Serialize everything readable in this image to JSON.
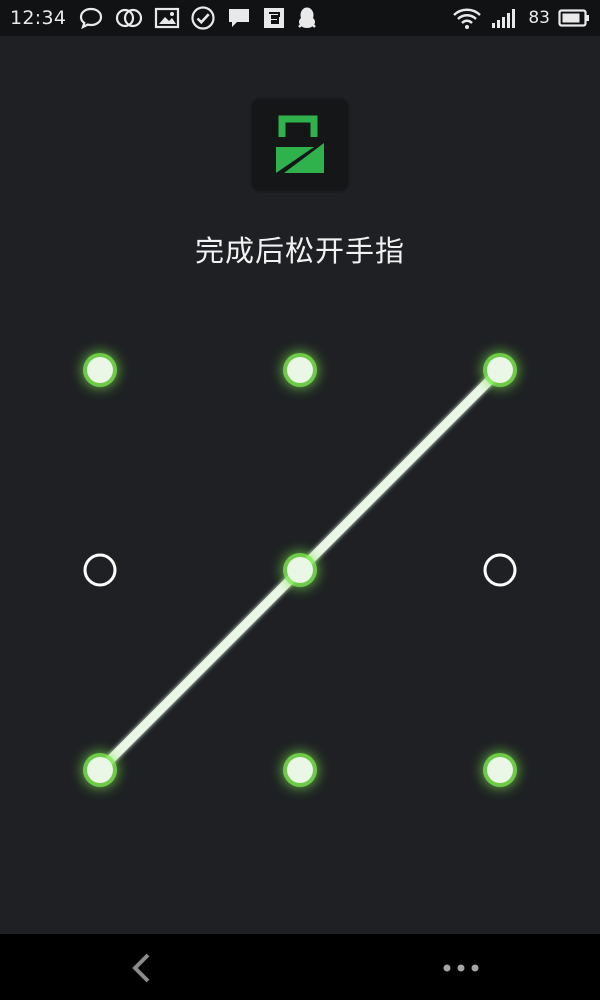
{
  "status_bar": {
    "time": "12:34",
    "battery_level": "83",
    "left_icons": [
      "chat-bubble-icon",
      "link-circles-icon",
      "image-icon",
      "check-circle-icon",
      "message-icon",
      "app-badge-icon",
      "qq-penguin-icon"
    ],
    "right_icons": [
      "wifi-icon",
      "signal-icon",
      "battery-icon"
    ]
  },
  "app": {
    "logo": "lock-app-icon",
    "accent_color": "#2fb24c"
  },
  "prompt": {
    "text": "完成后松开手指"
  },
  "pattern": {
    "grid": 3,
    "path_sequence": [
      1,
      2,
      3,
      5,
      7,
      8,
      9
    ],
    "active_color": "#eaf6e6",
    "glow_color": "#7be84f",
    "inactive_ring_color": "#ffffff"
  },
  "nav_bar": {
    "icons": [
      "back-icon",
      "more-icon"
    ]
  }
}
